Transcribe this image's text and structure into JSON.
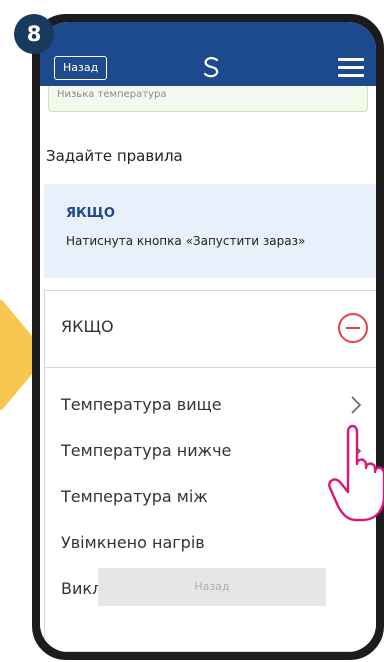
{
  "step_number": "8",
  "header": {
    "back_label": "Назад",
    "logo_icon": "salus-logo-icon",
    "menu_icon": "hamburger-menu-icon"
  },
  "previous_field": {
    "text": "Низька температура"
  },
  "rules": {
    "title": "Задайте правила"
  },
  "if_card": {
    "title": "ЯКЩО",
    "description": "Натиснута кнопка «Запустити зараз»"
  },
  "condition_panel": {
    "title": "ЯКЩО",
    "remove_icon": "minus-circle-icon",
    "options": [
      {
        "label": "Температура вище",
        "has_chevron": true
      },
      {
        "label": "Температура нижче",
        "has_chevron": true
      },
      {
        "label": "Температура між",
        "has_chevron": false
      },
      {
        "label": "Увімкнено нагрів",
        "has_chevron": false
      },
      {
        "label": "Виключено нагрів",
        "has_chevron": false
      }
    ]
  },
  "footer": {
    "back_label": "Назад"
  },
  "colors": {
    "header_bg": "#1d4a8c",
    "accent_red": "#e1463f",
    "accent_pink": "#e0137a",
    "arrow_yellow": "#f9c74f"
  }
}
